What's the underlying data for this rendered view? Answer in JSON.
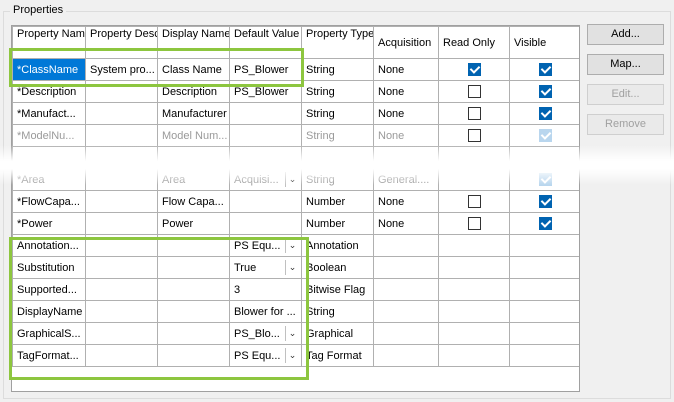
{
  "group_title": "Properties",
  "columns": [
    "Property Name",
    "Property Description",
    "Display Name",
    "Default Value",
    "Property Type",
    "Acquisition",
    "Read Only",
    "Visible"
  ],
  "rows": [
    {
      "name": "*ClassName",
      "desc": "System pro...",
      "display": "Class Name",
      "default": "PS_Blower",
      "type": "String",
      "acq": "None"
    },
    {
      "name": "*Description",
      "desc": "",
      "display": "Description",
      "default": "PS_Blower",
      "type": "String",
      "acq": "None"
    },
    {
      "name": "*Manufact...",
      "desc": "",
      "display": "Manufacturer",
      "default": "",
      "type": "String",
      "acq": "None"
    },
    {
      "name": "*ModelNu...",
      "desc": "",
      "display": "Model Num...",
      "default": "",
      "type": "String",
      "acq": "None"
    },
    {
      "name": "*Area",
      "desc": "",
      "display": "Area",
      "default": "Acquisi...",
      "type": "String",
      "acq": "General...."
    },
    {
      "name": "*FlowCapa...",
      "desc": "",
      "display": "Flow Capa...",
      "default": "",
      "type": "Number",
      "acq": "None"
    },
    {
      "name": "*Power",
      "desc": "",
      "display": "Power",
      "default": "",
      "type": "Number",
      "acq": "None"
    },
    {
      "name": "Annotation...",
      "desc": "",
      "display": "",
      "default": "PS Equ...",
      "type": "Annotation",
      "acq": ""
    },
    {
      "name": "Substitution",
      "desc": "",
      "display": "",
      "default": "True",
      "type": "Boolean",
      "acq": ""
    },
    {
      "name": "Supported...",
      "desc": "",
      "display": "",
      "default": "3",
      "type": "Bitwise Flag",
      "acq": ""
    },
    {
      "name": "DisplayName",
      "desc": "",
      "display": "",
      "default": "Blower for ...",
      "type": "String",
      "acq": ""
    },
    {
      "name": "GraphicalS...",
      "desc": "",
      "display": "",
      "default": "PS_Blo...",
      "type": "Graphical",
      "acq": ""
    },
    {
      "name": "TagFormat...",
      "desc": "",
      "display": "",
      "default": "PS Equ...",
      "type": "Tag Format",
      "acq": ""
    }
  ],
  "buttons": {
    "add": "Add...",
    "map": "Map...",
    "edit": "Edit...",
    "remove": "Remove"
  }
}
